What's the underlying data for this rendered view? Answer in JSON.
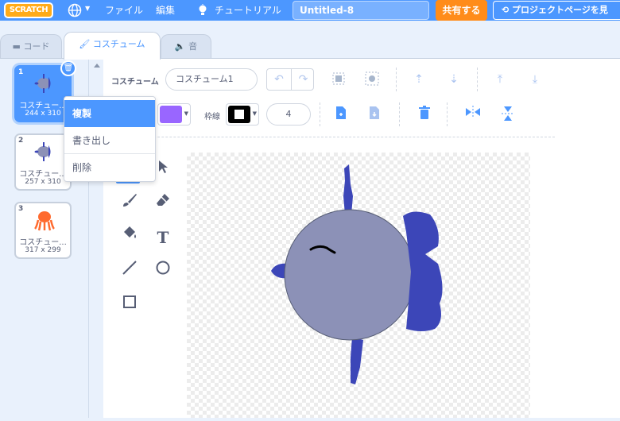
{
  "menubar": {
    "logo": "SCRATCH",
    "file": "ファイル",
    "edit": "編集",
    "tutorial": "チュートリアル",
    "project_title": "Untitled-8",
    "share": "共有する",
    "project_page": "プロジェクトページを見"
  },
  "tabs": {
    "code": "コード",
    "costumes": "コスチューム",
    "sounds": "音"
  },
  "costumes": [
    {
      "num": "1",
      "name": "コスチュー...",
      "size": "244 x 310"
    },
    {
      "num": "2",
      "name": "コスチュー...",
      "size": "257 x 310"
    },
    {
      "num": "3",
      "name": "コスチュー...",
      "size": "317 x 299"
    }
  ],
  "context_menu": {
    "duplicate": "複製",
    "export": "書き出し",
    "delete": "削除"
  },
  "editor": {
    "costume_label": "コスチューム",
    "costume_name": "コスチューム1",
    "outline_label": "枠線",
    "outline_width": "4",
    "fill_color": "#9966ff",
    "outline_color": "#000000"
  },
  "colors": {
    "accent": "#4c97ff",
    "share": "#ff8c1a",
    "fish_body": "#8c91b7",
    "fish_fins": "#3c46b8"
  }
}
